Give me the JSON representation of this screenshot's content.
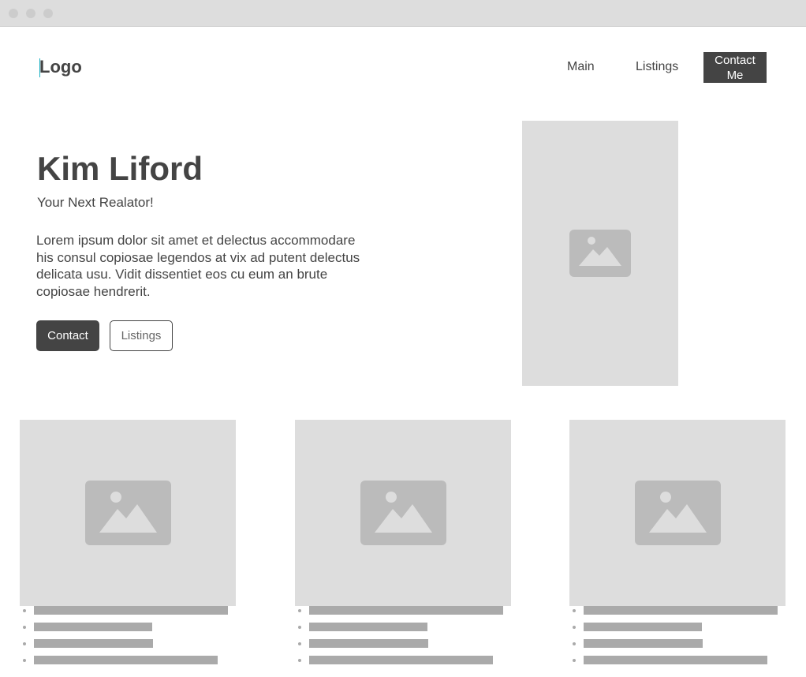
{
  "header": {
    "logo": "Logo",
    "nav": {
      "main": "Main",
      "listings": "Listings",
      "contact_line1": "Contact",
      "contact_line2": "Me"
    }
  },
  "hero": {
    "title": "Kim Liford",
    "subtitle": "Your Next Realator!",
    "body": "Lorem ipsum dolor sit amet et delectus accommodare his consul copiosae legendos at vix ad putent delectus delicata usu. Vidit dissentiet eos cu eum an brute copiosae hendrerit.",
    "buttons": {
      "contact": "Contact",
      "listings": "Listings"
    },
    "image_icon": "image-placeholder-icon"
  },
  "cards": [
    {
      "image_icon": "image-placeholder-icon",
      "list_lines": 4
    },
    {
      "image_icon": "image-placeholder-icon",
      "list_lines": 4
    },
    {
      "image_icon": "image-placeholder-icon",
      "list_lines": 4
    }
  ],
  "colors": {
    "dark": "#444444",
    "placeholder_bg": "#dddddd",
    "placeholder_icon": "#bbbbbb",
    "text_line": "#aaaaaa",
    "cursor": "#19b1c4"
  }
}
